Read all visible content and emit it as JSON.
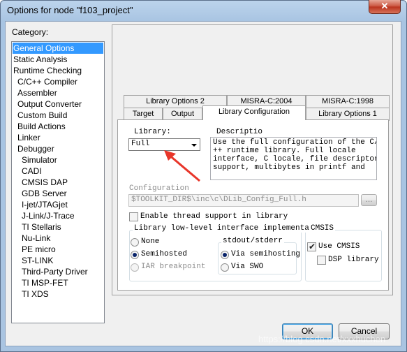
{
  "window": {
    "title": "Options for node \"f103_project\"",
    "close_glyph": "✕"
  },
  "category": {
    "label": "Category:",
    "items": [
      {
        "label": "General Options",
        "indent": false,
        "selected": true
      },
      {
        "label": "Static Analysis",
        "indent": false
      },
      {
        "label": "Runtime Checking",
        "indent": false
      },
      {
        "label": "C/C++ Compiler",
        "indent": true
      },
      {
        "label": "Assembler",
        "indent": true
      },
      {
        "label": "Output Converter",
        "indent": true
      },
      {
        "label": "Custom Build",
        "indent": true
      },
      {
        "label": "Build Actions",
        "indent": true
      },
      {
        "label": "Linker",
        "indent": true
      },
      {
        "label": "Debugger",
        "indent": true
      },
      {
        "label": "Simulator",
        "indent": "deep"
      },
      {
        "label": "CADI",
        "indent": "deep"
      },
      {
        "label": "CMSIS DAP",
        "indent": "deep"
      },
      {
        "label": "GDB Server",
        "indent": "deep"
      },
      {
        "label": "I-jet/JTAGjet",
        "indent": "deep"
      },
      {
        "label": "J-Link/J-Trace",
        "indent": "deep"
      },
      {
        "label": "TI Stellaris",
        "indent": "deep"
      },
      {
        "label": "Nu-Link",
        "indent": "deep"
      },
      {
        "label": "PE micro",
        "indent": "deep"
      },
      {
        "label": "ST-LINK",
        "indent": "deep"
      },
      {
        "label": "Third-Party Driver",
        "indent": "deep"
      },
      {
        "label": "TI MSP-FET",
        "indent": "deep"
      },
      {
        "label": "TI XDS",
        "indent": "deep"
      }
    ]
  },
  "tabs": {
    "row1": [
      "Library Options 2",
      "MISRA-C:2004",
      "MISRA-C:1998"
    ],
    "row2": [
      "Target",
      "Output",
      "Library Configuration",
      "Library Options 1"
    ],
    "active": "Library Configuration"
  },
  "library": {
    "label": "Library:",
    "value": "Full",
    "description_label": "Descriptio",
    "description": "Use the full configuration of the C/C\n++ runtime library. Full locale\ninterface, C locale, file descriptor\nsupport, multibytes in printf and",
    "config_label": "Configuration",
    "config_value": "$TOOLKIT_DIR$\\inc\\c\\DLib_Config_Full.h",
    "browse_label": "...",
    "thread_support_label": "Enable thread support in library",
    "thread_support_checked": false
  },
  "low_level": {
    "title": "Library low-level interface implementation",
    "options": [
      {
        "label": "None",
        "selected": false,
        "enabled": true
      },
      {
        "label": "Semihosted",
        "selected": true,
        "enabled": true
      },
      {
        "label": "IAR breakpoint",
        "selected": false,
        "enabled": false
      }
    ],
    "stdout_title": "stdout/stderr",
    "stdout_options": [
      {
        "label": "Via semihosting",
        "selected": true
      },
      {
        "label": "Via SWO",
        "selected": false
      }
    ]
  },
  "cmsis": {
    "title": "CMSIS",
    "use_cmsis_label": "Use CMSIS",
    "use_cmsis_checked": true,
    "dsp_label": "DSP library",
    "dsp_checked": false
  },
  "buttons": {
    "ok": "OK",
    "cancel": "Cancel"
  },
  "watermark": "https://blog.csdn.net/xxxhuchen",
  "colors": {
    "selection": "#3399ff",
    "annotation_arrow": "#e8362a"
  }
}
